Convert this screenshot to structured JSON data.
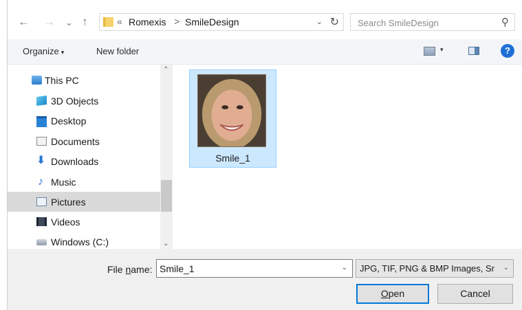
{
  "navigation": {
    "back_glyph": "←",
    "forward_glyph": "→",
    "recent_glyph": "⌄",
    "up_glyph": "↑"
  },
  "address_bar": {
    "overflow": "«",
    "crumbs": [
      "Romexis",
      "SmileDesign"
    ],
    "separator": ">",
    "dropdown_glyph": "⌄",
    "refresh_glyph": "↻"
  },
  "search": {
    "placeholder": "Search SmileDesign",
    "value": ""
  },
  "toolbar": {
    "organize_label": "Organize",
    "organize_caret": "▾",
    "new_folder_label": "New folder",
    "view_caret": "▾",
    "help_label": "?"
  },
  "nav_pane": {
    "items": [
      {
        "label": "This PC",
        "icon": "this-pc-icon"
      },
      {
        "label": "3D Objects",
        "icon": "3d-objects-icon"
      },
      {
        "label": "Desktop",
        "icon": "desktop-icon"
      },
      {
        "label": "Documents",
        "icon": "documents-icon"
      },
      {
        "label": "Downloads",
        "icon": "downloads-icon"
      },
      {
        "label": "Music",
        "icon": "music-icon"
      },
      {
        "label": "Pictures",
        "icon": "pictures-icon",
        "selected": true
      },
      {
        "label": "Videos",
        "icon": "videos-icon"
      },
      {
        "label": "Windows (C:)",
        "icon": "drive-icon"
      }
    ],
    "scroll_up_glyph": "⌃",
    "scroll_down_glyph": "⌄"
  },
  "files": [
    {
      "name": "Smile_1",
      "selected": true
    }
  ],
  "footer": {
    "file_name_label_prefix": "File ",
    "file_name_label_access": "n",
    "file_name_label_suffix": "ame:",
    "file_name_value": "Smile_1",
    "file_type": "JPG, TIF, PNG & BMP Images, Sr",
    "dropdown_glyph": "⌄",
    "open_label_access": "O",
    "open_label_rest": "pen",
    "cancel_label": "Cancel"
  },
  "colors": {
    "selection": "#cce8ff",
    "selection_border": "#99d1ff",
    "accent": "#0078d7",
    "help": "#1f6fd6"
  }
}
